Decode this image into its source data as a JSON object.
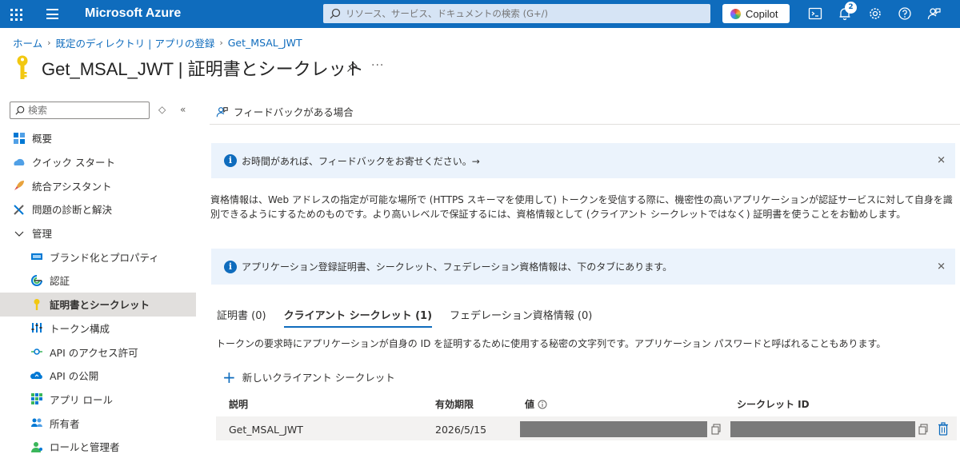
{
  "topbar": {
    "brand": "Microsoft Azure",
    "search_placeholder": "リソース、サービス、ドキュメントの検索 (G+/)",
    "copilot_label": "Copilot",
    "notification_count": "2",
    "accent": "#0f6cbd"
  },
  "breadcrumb": {
    "items": [
      "ホーム",
      "既定のディレクトリ | アプリの登録",
      "Get_MSAL_JWT"
    ]
  },
  "page": {
    "title": "Get_MSAL_JWT | 証明書とシークレット",
    "more": "···"
  },
  "sidebar": {
    "search_placeholder": "検索",
    "items": [
      {
        "label": "概要",
        "icon": "overview-icon"
      },
      {
        "label": "クイック スタート",
        "icon": "quickstart-icon"
      },
      {
        "label": "統合アシスタント",
        "icon": "rocket-icon"
      },
      {
        "label": "問題の診断と解決",
        "icon": "wrench-icon"
      },
      {
        "label": "管理",
        "icon": "chevron-down-icon"
      },
      {
        "label": "ブランド化とプロパティ",
        "icon": "branding-icon"
      },
      {
        "label": "認証",
        "icon": "auth-icon"
      },
      {
        "label": "証明書とシークレット",
        "icon": "key-icon"
      },
      {
        "label": "トークン構成",
        "icon": "token-icon"
      },
      {
        "label": "API のアクセス許可",
        "icon": "api-permission-icon"
      },
      {
        "label": "API の公開",
        "icon": "cloud-icon"
      },
      {
        "label": "アプリ ロール",
        "icon": "app-roles-icon"
      },
      {
        "label": "所有者",
        "icon": "owners-icon"
      },
      {
        "label": "ロールと管理者",
        "icon": "admin-icon"
      }
    ]
  },
  "content": {
    "feedback_label": "フィードバックがある場合",
    "banner1": "お時間があれば、フィードバックをお寄せください。→",
    "description": "資格情報は、Web アドレスの指定が可能な場所で (HTTPS スキーマを使用して) トークンを受信する際に、機密性の高いアプリケーションが認証サービスに対して自身を識別できるようにするためのものです。より高いレベルで保証するには、資格情報として (クライアント シークレットではなく) 証明書を使うことをお勧めします。",
    "banner2": "アプリケーション登録証明書、シークレット、フェデレーション資格情報は、下のタブにあります。",
    "tabs": [
      "証明書 (0)",
      "クライアント シークレット (1)",
      "フェデレーション資格情報 (0)"
    ],
    "tab_description": "トークンの要求時にアプリケーションが自身の ID を証明するために使用する秘密の文字列です。アプリケーション パスワードと呼ばれることもあります。",
    "new_secret_label": "新しいクライアント シークレット",
    "table": {
      "headers": [
        "説明",
        "有効期限",
        "値",
        "シークレット ID"
      ],
      "rows": [
        {
          "description": "Get_MSAL_JWT",
          "expires": "2026/5/15"
        }
      ]
    }
  }
}
